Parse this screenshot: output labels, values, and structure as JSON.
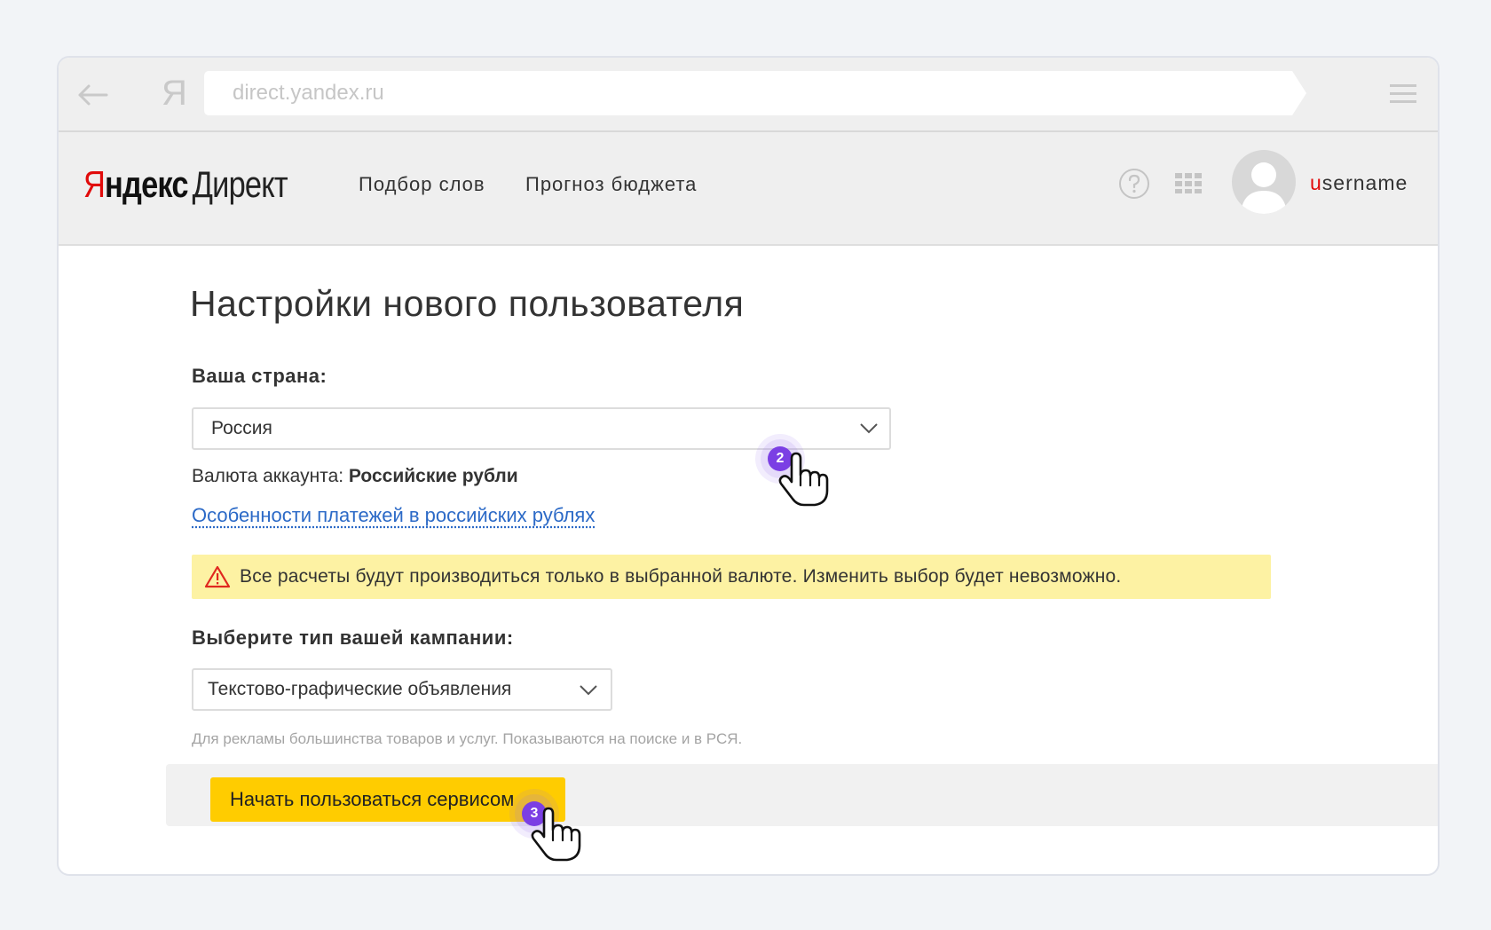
{
  "browser": {
    "url": "direct.yandex.ru",
    "ya_glyph": "Я"
  },
  "header": {
    "logo": {
      "part1": "Я",
      "part2": "ндекс",
      "part3": "Директ"
    },
    "nav": [
      "Подбор слов",
      "Прогноз бюджета"
    ],
    "username_first": "u",
    "username_rest": "sername"
  },
  "main": {
    "title": "Настройки нового пользователя",
    "country_label": "Ваша страна:",
    "country_value": "Россия",
    "currency_prefix": "Валюта аккаунта: ",
    "currency_value": "Российские рубли",
    "payment_link": "Особенности платежей в российских рублях",
    "warning": "Все расчеты будут производиться только в выбранной валюте.  Изменить выбор будет невозможно.",
    "campaign_label": "Выберите тип вашей кампании:",
    "campaign_value": "Текстово-графические объявления",
    "campaign_hint": "Для рекламы большинства товаров и услуг. Показываются на поиске и в РСЯ.",
    "start_button": "Начать пользоваться сервисом"
  },
  "annotations": {
    "step_2": "2",
    "step_3": "3"
  },
  "colors": {
    "accent_red": "#e10b0b",
    "button_yellow": "#ffcc00",
    "warning_bg": "#fdf2a3",
    "link_blue": "#2c6ac7",
    "step_purple": "#7b3fe4"
  }
}
